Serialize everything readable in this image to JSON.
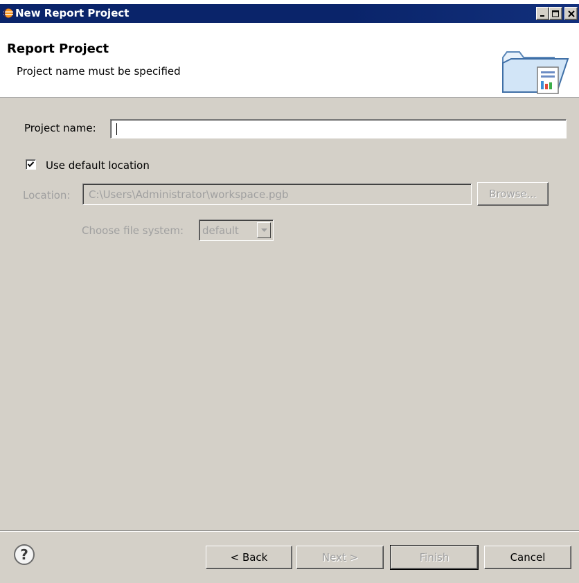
{
  "window": {
    "title": "New Report Project",
    "icon": "eclipse-icon"
  },
  "banner": {
    "title": "Report Project",
    "message": "Project name must be specified",
    "icon": "folder-report-icon"
  },
  "form": {
    "project_name_label": "Project name:",
    "project_name_value": "",
    "use_default_label": "Use default location",
    "use_default_checked": true,
    "location_label": "Location:",
    "location_value": "C:\\Users\\Administrator\\workspace.pgb",
    "browse_label": "Browse...",
    "file_system_label": "Choose file system:",
    "file_system_value": "default"
  },
  "footer": {
    "help_icon": "help-icon",
    "back_label": "< Back",
    "next_label": "Next >",
    "finish_label": "Finish",
    "cancel_label": "Cancel"
  }
}
